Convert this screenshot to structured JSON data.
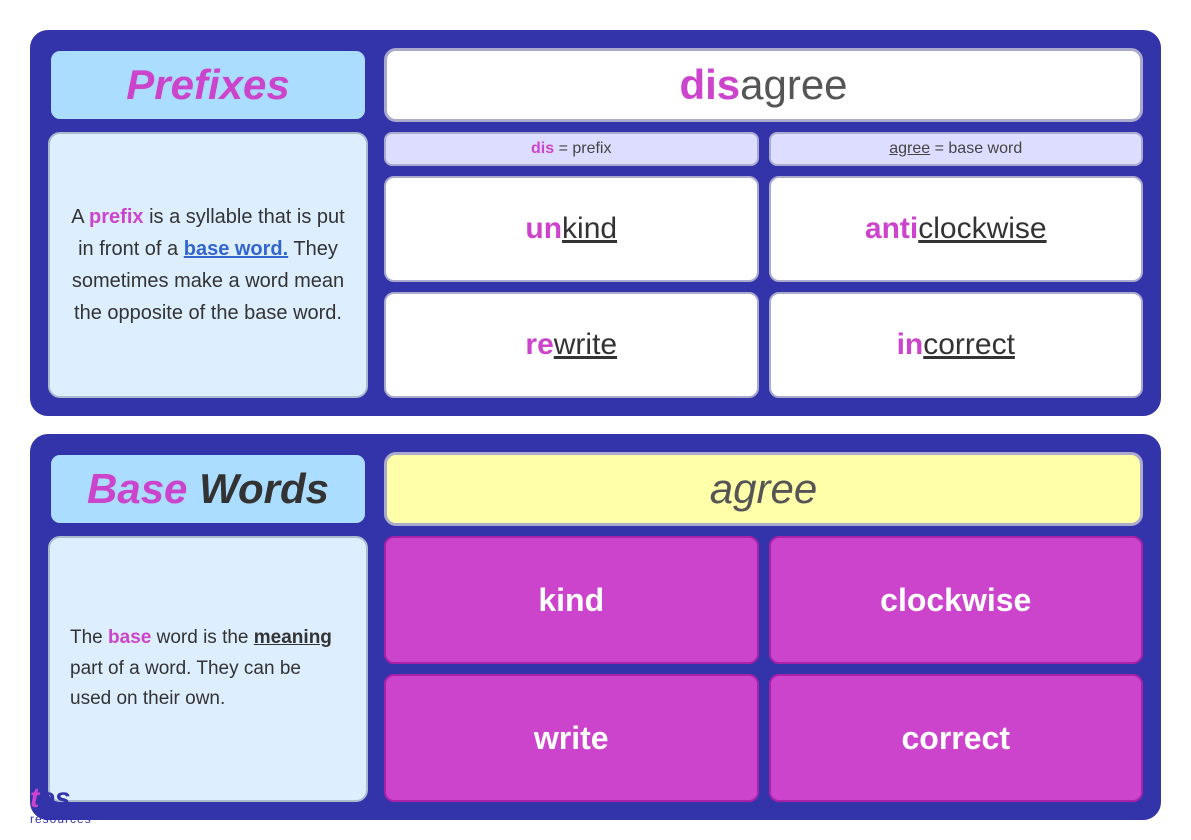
{
  "top": {
    "prefixes_title": "Prefixes",
    "prefixes_description_1": "A ",
    "prefixes_highlight1": "prefix",
    "prefixes_description_2": " is a syllable that is put in front of a ",
    "prefixes_highlight2": "base word.",
    "prefixes_description_3": " They sometimes make a word mean the opposite of the base word.",
    "disagree_word": "disagree",
    "dis_part": "dis",
    "agree_part": "agree",
    "label_dis": "dis = prefix",
    "label_dis_prefix": "dis",
    "label_agree": "agree = base word",
    "label_agree_base": "agree",
    "word1_prefix": "un",
    "word1_base": "kind",
    "word2_prefix": "anti",
    "word2_base": "clockwise",
    "word3_prefix": "re",
    "word3_base": "write",
    "word4_prefix": "in",
    "word4_base": "correct"
  },
  "bottom": {
    "basewords_title_highlight": "Base",
    "basewords_title_rest": " Words",
    "basewords_desc_1": "The ",
    "basewords_highlight1": "base",
    "basewords_desc_2": " word is the ",
    "basewords_highlight2": "meaning",
    "basewords_desc_3": " part of a word. They can be used on their own.",
    "agree_word": "agree",
    "bw1": "kind",
    "bw2": "clockwise",
    "bw3": "write",
    "bw4": "correct"
  },
  "logo": {
    "tes": "tes",
    "resources": "resources"
  }
}
